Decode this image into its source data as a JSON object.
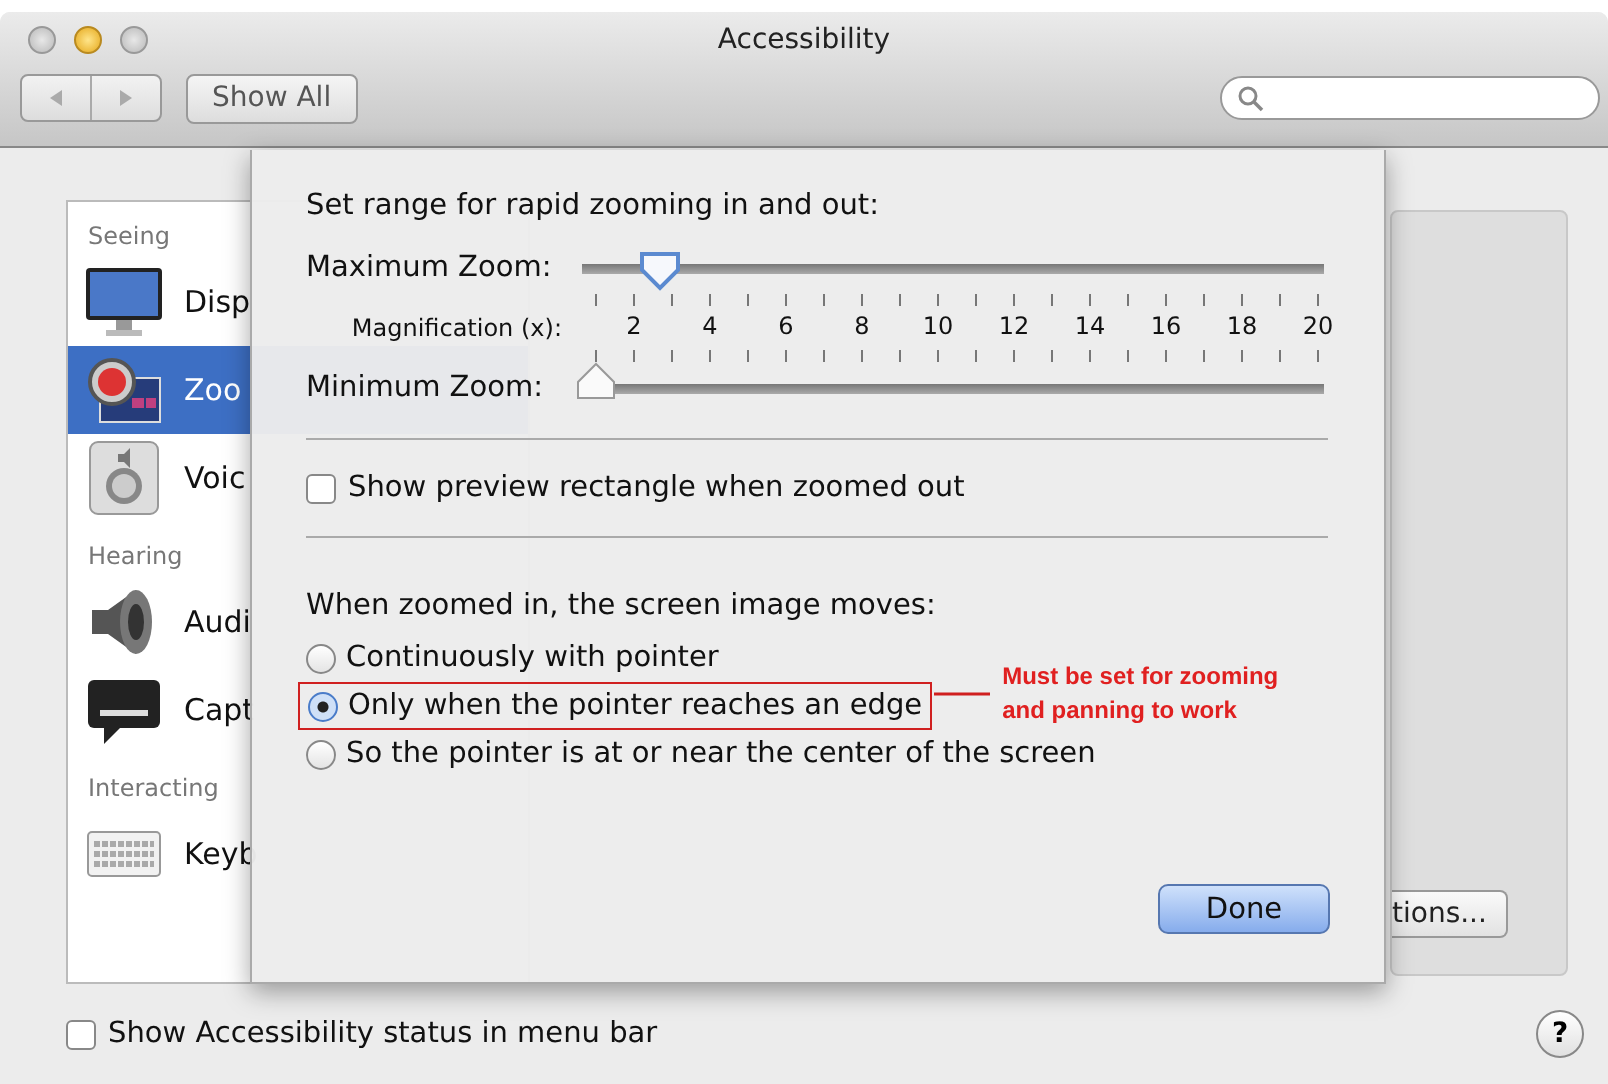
{
  "window": {
    "title": "Accessibility"
  },
  "toolbar": {
    "show_all": "Show All"
  },
  "sidebar": {
    "items": [
      {
        "kind": "header",
        "label": "Seeing"
      },
      {
        "kind": "item",
        "label": "Disp",
        "selected": false
      },
      {
        "kind": "item",
        "label": "Zoo",
        "selected": true
      },
      {
        "kind": "item",
        "label": "Voic",
        "selected": false
      },
      {
        "kind": "header",
        "label": "Hearing"
      },
      {
        "kind": "item",
        "label": "Audi",
        "selected": false
      },
      {
        "kind": "item",
        "label": "Capt",
        "selected": false
      },
      {
        "kind": "header",
        "label": "Interacting"
      },
      {
        "kind": "item",
        "label": "Keyb",
        "selected": false
      }
    ]
  },
  "background_panel": {
    "button": "tions..."
  },
  "sheet": {
    "heading": "Set range for rapid zooming in and out:",
    "sliders": [
      {
        "label": "Maximum Zoom:",
        "level": 0.09
      },
      {
        "label": "Minimum Zoom:",
        "level": 0
      }
    ],
    "scale": {
      "label": "Magnification (x):",
      "ticks": [
        "2",
        "4",
        "6",
        "8",
        "10",
        "12",
        "14",
        "16",
        "18",
        "20"
      ]
    },
    "preview_checkbox": {
      "label": "Show preview rectangle when zoomed out",
      "checked": false
    },
    "moves_heading": "When zoomed in, the screen image moves:",
    "options": [
      {
        "label": "Continuously with pointer",
        "selected": false
      },
      {
        "label": "Only when the pointer reaches an edge",
        "selected": true,
        "annotation": [
          "Must be set for zooming",
          "and panning to work"
        ]
      },
      {
        "label": "So the pointer is at or near the center of the screen",
        "selected": false
      }
    ],
    "done_button": "Done"
  },
  "footer": {
    "checkbox": {
      "label": "Show Accessibility status in menu bar",
      "checked": false
    },
    "help": "?"
  }
}
